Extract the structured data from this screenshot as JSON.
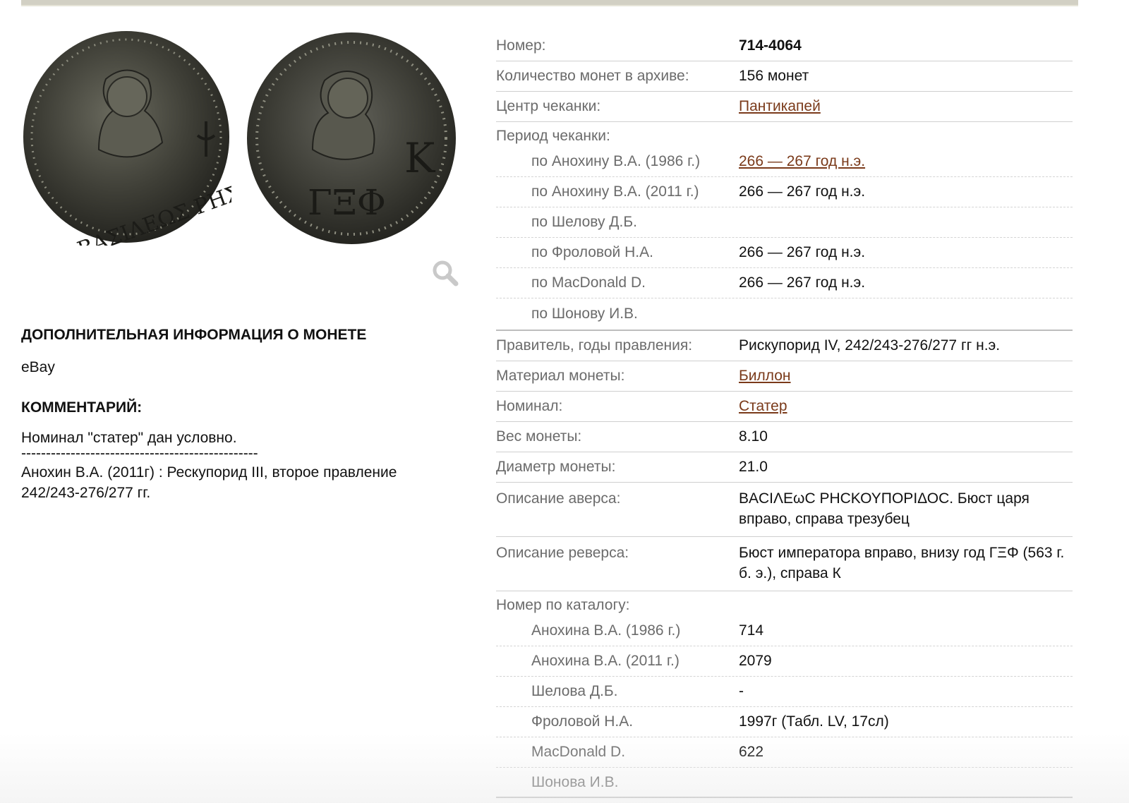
{
  "coin_images": {
    "obverse_alt": "obverse",
    "reverse_alt": "reverse",
    "obverse_legend": "ΒΑΣΙΛΕΩΣ ΡΗΣΚΟΥΠΟΡΙΔΟΣ",
    "reverse_letters_bottom": "ΓΞΦ",
    "reverse_letter_right": "Κ",
    "zoom_icon": "magnifier-icon"
  },
  "extra_info": {
    "heading": "ДОПОЛНИТЕЛЬНАЯ ИНФОРМАЦИЯ О МОНЕТЕ",
    "source": "eBay",
    "comment_heading": "КОММЕНТАРИЙ:",
    "comment_line1": "Номинал \"статер\" дан условно.",
    "separator": "------------------------------------------------",
    "comment_line2": "Анохин В.А. (2011г) : Рескупорид III, второе правление 242/243-276/277 гг."
  },
  "specs": {
    "number_label": "Номер:",
    "number_value": "714-4064",
    "archive_count_label": "Количество монет в архиве:",
    "archive_count_value": "156 монет",
    "mint_label": "Центр чеканки:",
    "mint_value": "Пантикапей",
    "period_label": "Период чеканки:",
    "period_rows": [
      {
        "label": "по Анохину В.А. (1986 г.)",
        "value": "266 — 267 год н.э.",
        "link": true
      },
      {
        "label": "по Анохину В.А. (2011 г.)",
        "value": "266 — 267 год н.э."
      },
      {
        "label": "по Шелову Д.Б.",
        "value": ""
      },
      {
        "label": "по Фроловой Н.А.",
        "value": "266 — 267 год н.э."
      },
      {
        "label": "по MacDonald D.",
        "value": "266 — 267 год н.э."
      },
      {
        "label": "по Шонову И.В.",
        "value": ""
      }
    ],
    "ruler_label": "Правитель, годы правления:",
    "ruler_value": "Рискупорид IV, 242/243-276/277 гг н.э.",
    "material_label": "Материал монеты:",
    "material_value": "Биллон",
    "denomination_label": "Номинал:",
    "denomination_value": "Статер",
    "weight_label": "Вес монеты:",
    "weight_value": "8.10",
    "diameter_label": "Диаметр монеты:",
    "diameter_value": "21.0",
    "obverse_label": "Описание аверса:",
    "obverse_value": "ΒΑCΙΛΕωC ΡΗCΚΟΥΠΟΡΙΔΟC. Бюст царя вправо, справа трезубец",
    "reverse_label": "Описание реверса:",
    "reverse_value": "Бюст императора вправо, внизу год ΓΞΦ (563 г. б. э.), справа К",
    "catalog_label": "Номер по каталогу:",
    "catalog_rows": [
      {
        "label": "Анохина В.А. (1986 г.)",
        "value": "714"
      },
      {
        "label": "Анохина В.А. (2011 г.)",
        "value": "2079"
      },
      {
        "label": "Шелова Д.Б.",
        "value": "-"
      },
      {
        "label": "Фроловой Н.А.",
        "value": "1997г (Табл. LV, 17сл)"
      },
      {
        "label": "MacDonald D.",
        "value": "622"
      },
      {
        "label": "Шонова И.В.",
        "value": ""
      }
    ]
  },
  "colors": {
    "link": "#7a3a1a",
    "label": "#6b6b6b",
    "coin_dark": "#2b2b27",
    "coin_mid": "#4a4a42"
  }
}
